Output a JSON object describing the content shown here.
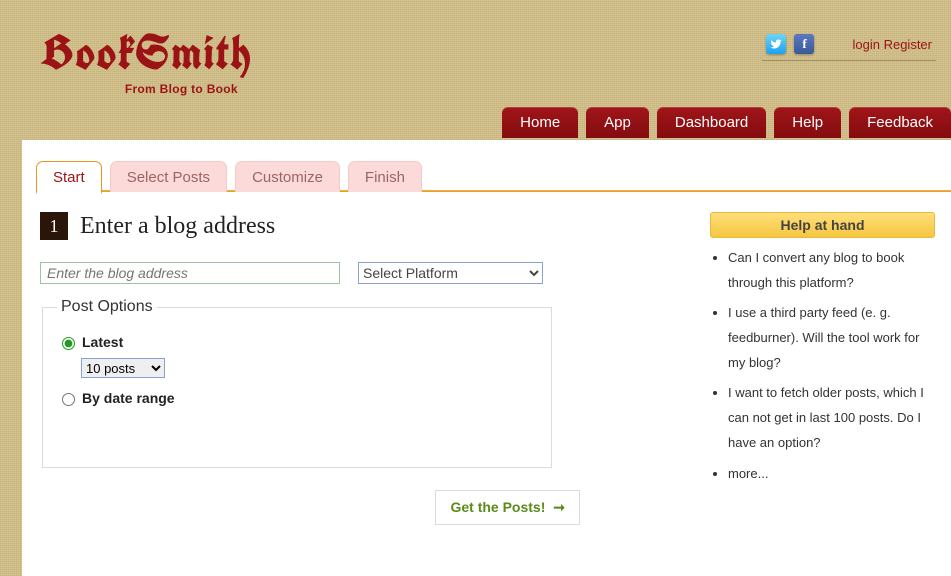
{
  "header": {
    "logo_title": "BookSmith",
    "tagline": "From Blog to Book",
    "auth": {
      "login": "login",
      "register": "Register"
    },
    "social": {
      "twitter": "twitter-icon",
      "facebook": "facebook-icon"
    }
  },
  "nav": {
    "home": "Home",
    "app": "App",
    "dashboard": "Dashboard",
    "help": "Help",
    "feedback": "Feedback"
  },
  "wizard": {
    "tabs": {
      "start": "Start",
      "select_posts": "Select Posts",
      "customize": "Customize",
      "finish": "Finish"
    },
    "step_number": "1",
    "step_heading": "Enter a blog address",
    "blog_input_placeholder": "Enter the blog address",
    "platform_select_label": "Select Platform",
    "post_options": {
      "legend": "Post Options",
      "radio_latest": "Latest",
      "posts_count_value": "10 posts",
      "radio_daterange": "By date range"
    },
    "get_posts_label": "Get the Posts!"
  },
  "help_panel": {
    "title": "Help at hand",
    "items": [
      "Can I convert any blog to book through this platform?",
      "I use a third party feed (e. g. feedburner). Will the tool work for my blog?",
      "I want to fetch older posts, which I can not get in last 100 posts. Do I have an option?",
      "more..."
    ]
  }
}
